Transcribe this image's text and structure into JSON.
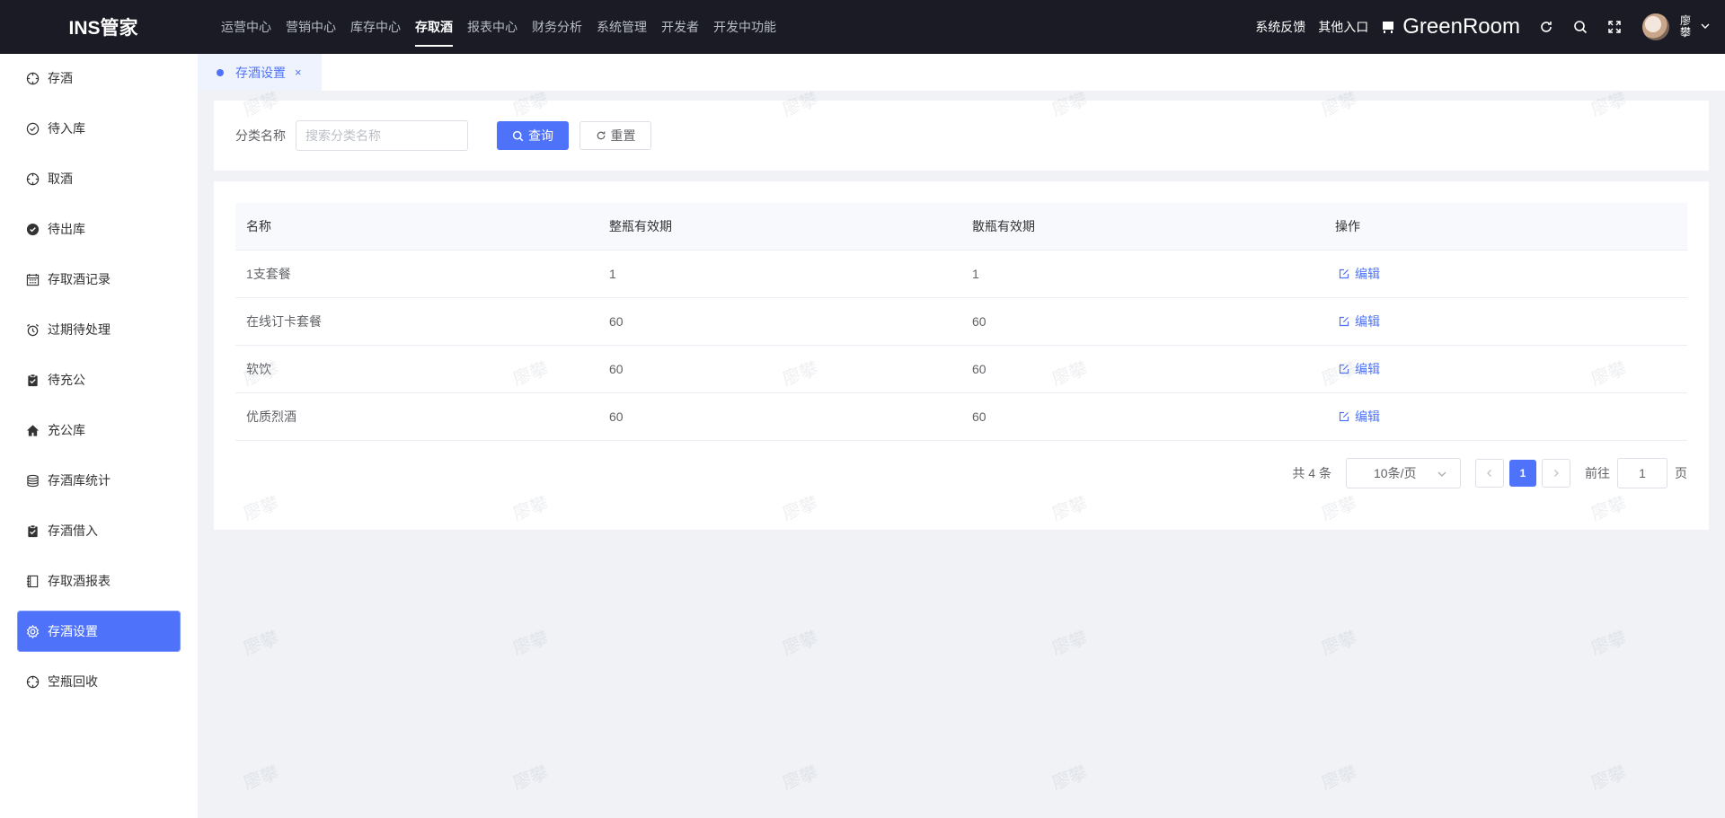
{
  "header": {
    "brand": "INS管家",
    "nav": [
      "运营中心",
      "营销中心",
      "库存中心",
      "存取酒",
      "报表中心",
      "财务分析",
      "系统管理",
      "开发者",
      "开发中功能"
    ],
    "feedback": "系统反馈",
    "other_entry": "其他入口",
    "store_name": "GreenRoom",
    "user_name": "廖攀"
  },
  "sidebar": {
    "items": [
      {
        "label": "存酒",
        "icon": "compass-icon"
      },
      {
        "label": "待入库",
        "icon": "check-circle-icon"
      },
      {
        "label": "取酒",
        "icon": "compass-icon"
      },
      {
        "label": "待出库",
        "icon": "check-circle-filled-icon"
      },
      {
        "label": "存取酒记录",
        "icon": "calendar-icon"
      },
      {
        "label": "过期待处理",
        "icon": "alarm-clock-icon"
      },
      {
        "label": "待充公",
        "icon": "clipboard-check-icon"
      },
      {
        "label": "充公库",
        "icon": "home-icon"
      },
      {
        "label": "存酒库统计",
        "icon": "database-icon"
      },
      {
        "label": "存酒借入",
        "icon": "clipboard-check-icon"
      },
      {
        "label": "存取酒报表",
        "icon": "notebook-icon"
      },
      {
        "label": "存酒设置",
        "icon": "gear-icon"
      },
      {
        "label": "空瓶回收",
        "icon": "aim-icon"
      }
    ]
  },
  "tabs": [
    {
      "label": "存酒设置",
      "close": "×"
    }
  ],
  "search": {
    "label": "分类名称",
    "placeholder": "搜索分类名称",
    "value": "",
    "query_label": "查询",
    "reset_label": "重置"
  },
  "table": {
    "headers": [
      "名称",
      "整瓶有效期",
      "散瓶有效期",
      "操作"
    ],
    "rows": [
      [
        "1支套餐",
        "1",
        "1",
        "编辑"
      ],
      [
        "在线订卡套餐",
        "60",
        "60",
        "编辑"
      ],
      [
        "软饮",
        "60",
        "60",
        "编辑"
      ],
      [
        "优质烈酒",
        "60",
        "60",
        "编辑"
      ]
    ]
  },
  "pagination": {
    "total": "共 4 条",
    "page_size": "10条/页",
    "current_page": "1",
    "goto_label": "前往",
    "goto_value": "1",
    "goto_suffix": "页"
  },
  "watermark": "廖攀",
  "colors": {
    "primary": "#4e73fa",
    "topbar": "#1a1b24"
  }
}
